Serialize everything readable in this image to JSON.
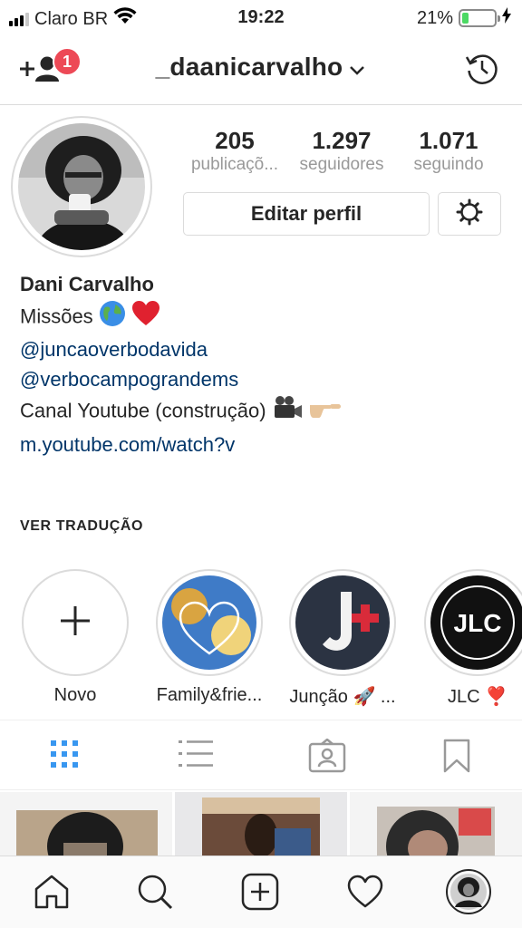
{
  "status_bar": {
    "carrier": "Claro BR",
    "time": "19:22",
    "battery_percent": "21%",
    "battery_level": 0.21,
    "battery_color": "#4cd964"
  },
  "header": {
    "username": "_daanicarvalho",
    "notification_count": "1",
    "badge_color": "#ed4956",
    "icons": [
      "add-user-icon",
      "chevron-down-icon",
      "history-icon"
    ]
  },
  "profile": {
    "stats": [
      {
        "value": "205",
        "label": "publicaçõ..."
      },
      {
        "value": "1.297",
        "label": "seguidores"
      },
      {
        "value": "1.071",
        "label": "seguindo"
      }
    ],
    "edit_button": "Editar perfil",
    "settings_icon": "gear-icon"
  },
  "bio": {
    "name": "Dani Carvalho",
    "line1": "Missões",
    "line1_emojis": [
      "globe-emoji",
      "red-heart-emoji"
    ],
    "mention1": "@juncaoverbodavida",
    "mention2": "@verbocampograndems",
    "line4": "Canal Youtube (construção)",
    "line4_emojis": [
      "movie-camera-emoji",
      "pointing-hand-emoji"
    ],
    "url": "m.youtube.com/watch?v",
    "link_color": "#003569"
  },
  "see_translation": "VER TRADUÇÃO",
  "highlights": [
    {
      "label": "Novo"
    },
    {
      "label": "Family&frie..."
    },
    {
      "label": "Junção 🚀 ..."
    },
    {
      "label": "JLC ❣️"
    }
  ],
  "tabs": [
    "grid-icon",
    "list-icon",
    "tagged-icon",
    "saved-icon"
  ],
  "active_tab": "grid-icon",
  "accent_color": "#3897f0",
  "bottom_nav": [
    "home-icon",
    "search-icon",
    "new-post-icon",
    "activity-icon",
    "profile-icon"
  ]
}
